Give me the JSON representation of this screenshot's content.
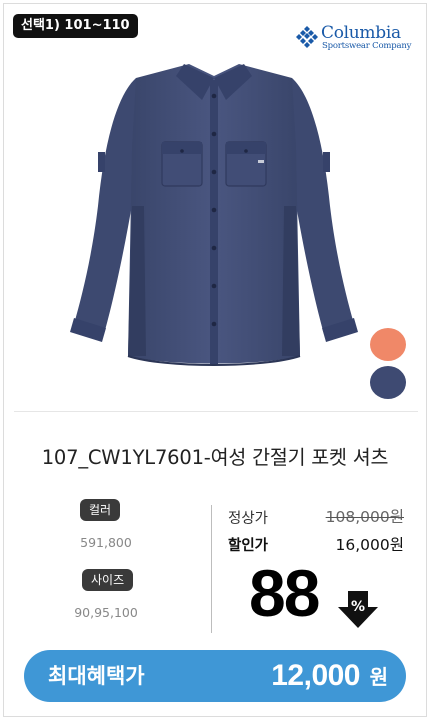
{
  "option_badge": "선택1) 101~110",
  "brand": {
    "name": "Columbia",
    "subtitle": "Sportswear Company",
    "color": "#1a5aa8",
    "icon": "columbia-diamond-icon"
  },
  "product": {
    "image_icon": "navy-shirt-image",
    "name": "107_CW1YL7601-여성 간절기 포켓 셔츠"
  },
  "swatches": [
    {
      "name": "coral",
      "color": "#f08868"
    },
    {
      "name": "navy",
      "color": "#3e4a72"
    }
  ],
  "attributes": {
    "color_label": "컬러",
    "color_value": "591,800",
    "size_label": "사이즈",
    "size_value": "90,95,100"
  },
  "pricing": {
    "regular_label": "정상가",
    "regular_price": "108,000원",
    "discount_label": "할인가",
    "discount_price": "16,000원",
    "discount_rate": "88",
    "rate_unit": "%",
    "rate_icon": "down-arrow-icon"
  },
  "benefit": {
    "label": "최대혜택가",
    "price": "12,000",
    "unit": "원",
    "color": "#3f97d6"
  }
}
